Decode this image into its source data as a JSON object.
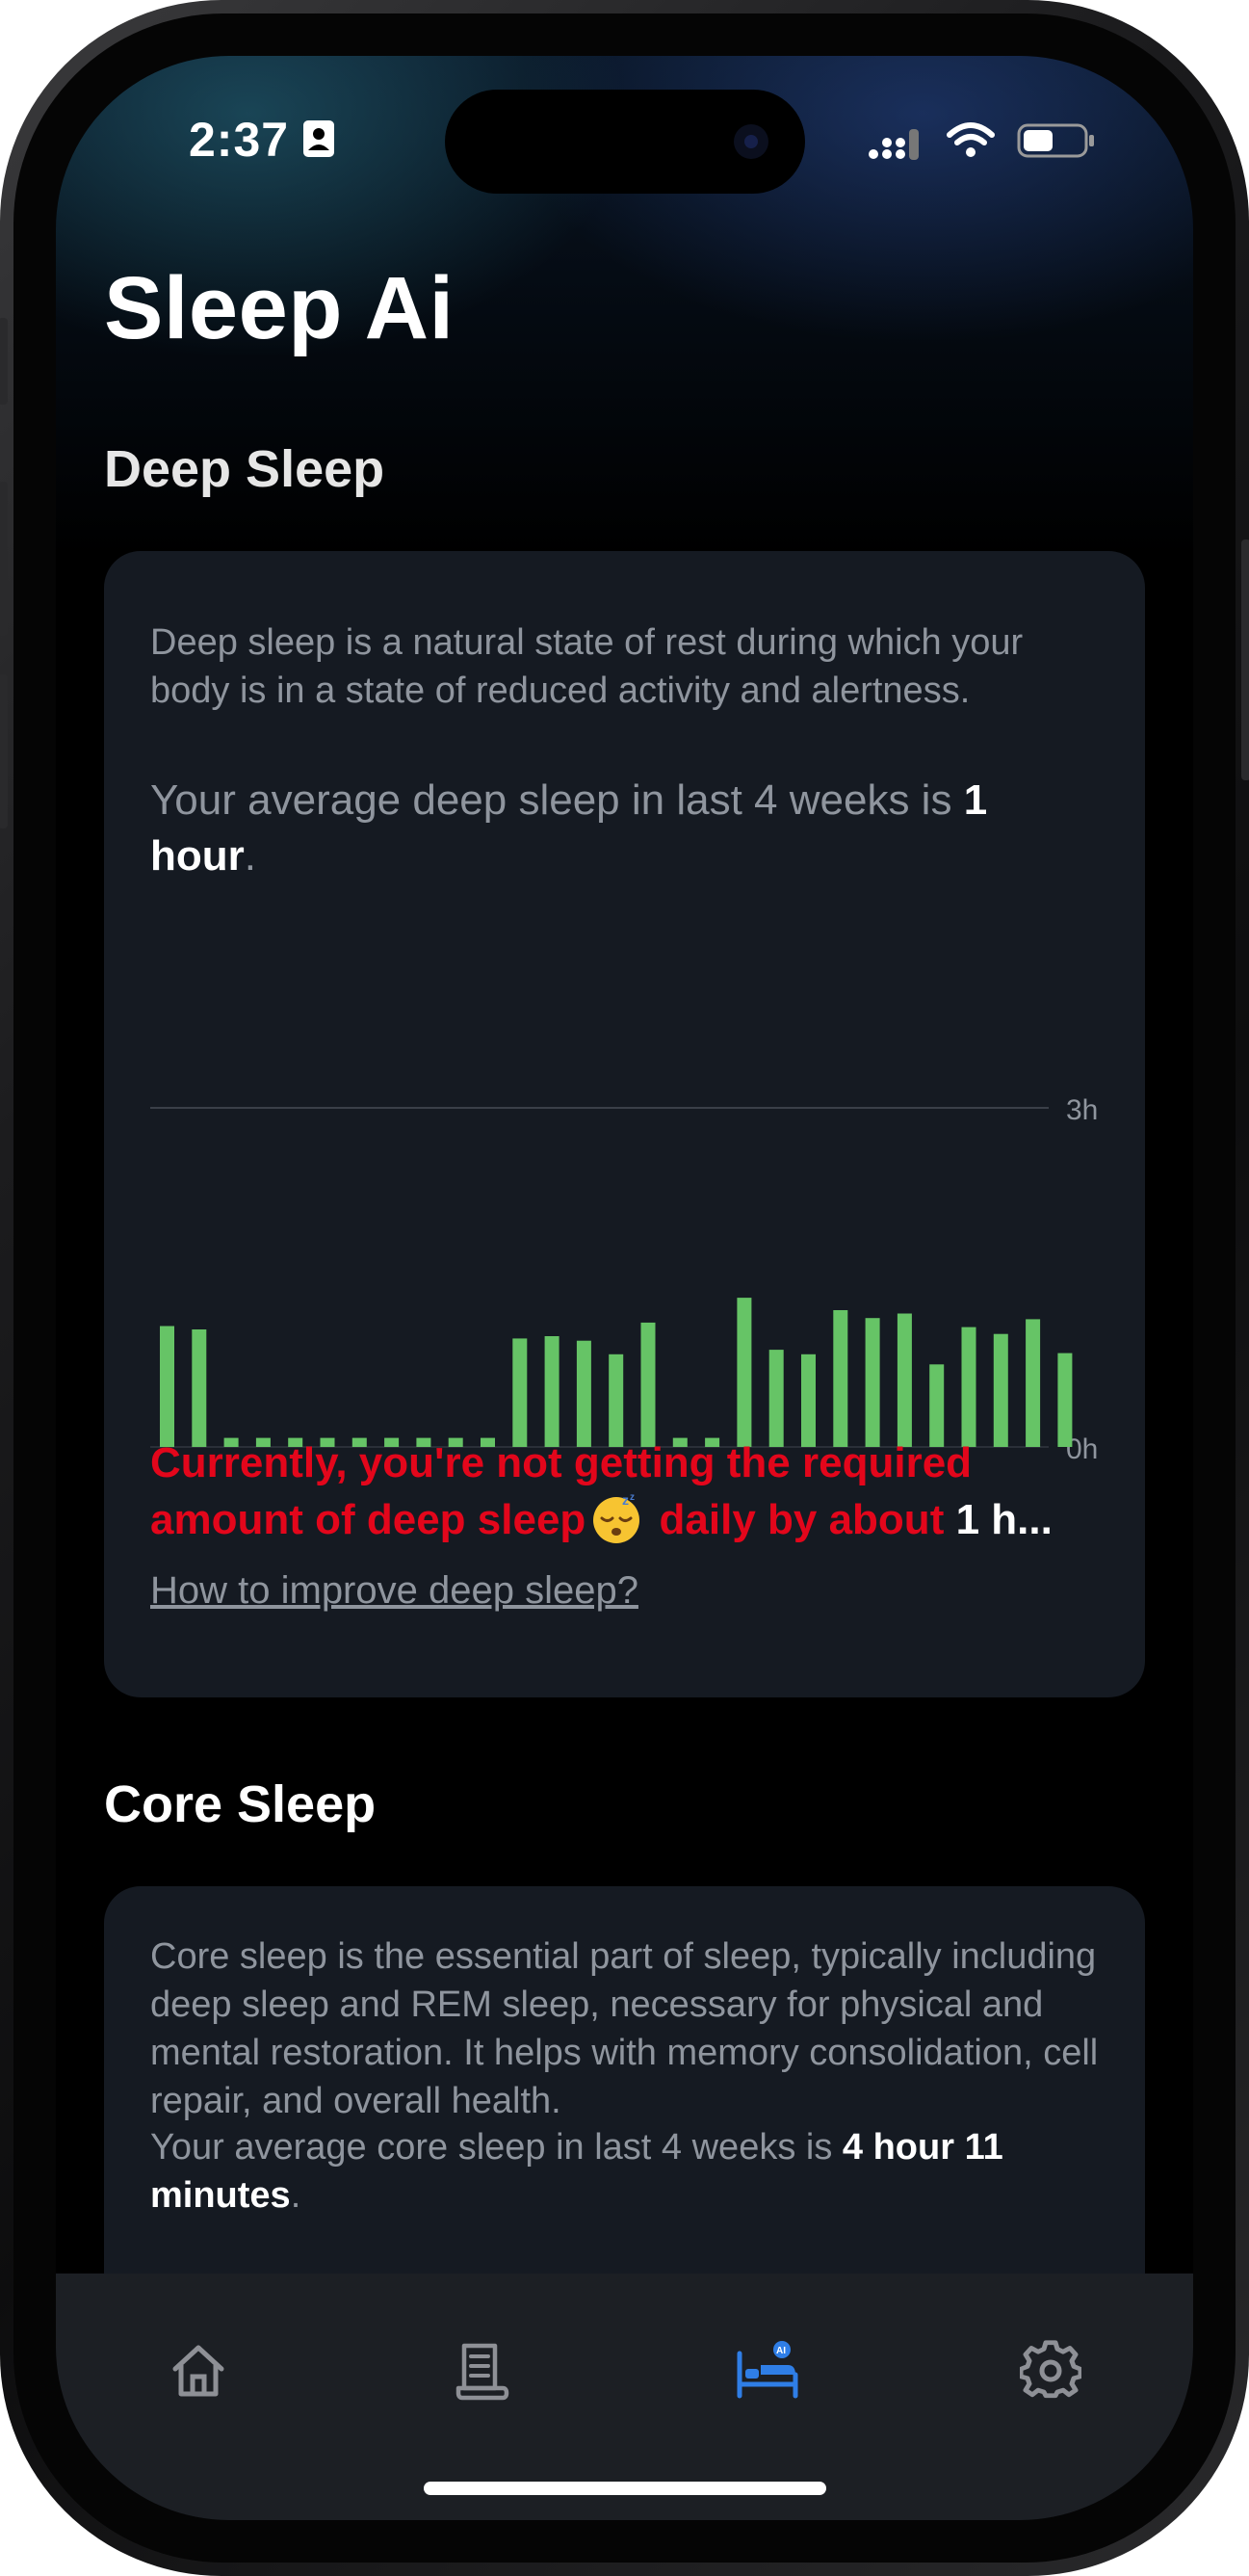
{
  "status_bar": {
    "time": "2:37"
  },
  "app": {
    "title": "Sleep Ai"
  },
  "deep_sleep": {
    "section_title": "Deep Sleep",
    "description": "Deep sleep is a natural state of rest during which your body is in a state of reduced activity and alertness.",
    "avg_prefix": "Your average deep sleep in last 4 weeks is ",
    "avg_value": "1 hour",
    "avg_suffix": ".",
    "warning_prefix": "Currently, you're not getting the required amount of deep sleep",
    "warning_middle": " daily by about ",
    "warning_value": "1 h...",
    "improve_link": "How to improve deep sleep?"
  },
  "core_sleep": {
    "section_title": "Core Sleep",
    "description": "Core sleep is the essential part of sleep, typically including deep sleep and REM sleep, necessary for physical and mental restoration. It helps with memory consolidation, cell repair, and overall health.",
    "avg_prefix": "Your average core sleep in last 4 weeks is ",
    "avg_value": "4 hour 11 minutes",
    "avg_suffix": "."
  },
  "chart_data": {
    "type": "bar",
    "unit": "hours",
    "ylim": [
      0,
      3
    ],
    "tick_labels": [
      "3h",
      "0h"
    ],
    "bar_color": "#66c466",
    "values": [
      1.07,
      1.04,
      0.08,
      0.08,
      0.08,
      0.08,
      0.08,
      0.08,
      0.08,
      0.08,
      0.08,
      0.96,
      0.98,
      0.94,
      0.82,
      1.1,
      0.08,
      0.08,
      1.32,
      0.86,
      0.82,
      1.21,
      1.14,
      1.18,
      0.73,
      1.06,
      1.0,
      1.13,
      0.83
    ]
  },
  "tab_bar": {
    "items": [
      {
        "name": "home",
        "icon": "home-icon",
        "active": false
      },
      {
        "name": "journal",
        "icon": "journal-icon",
        "active": false
      },
      {
        "name": "sleep-ai",
        "icon": "sleep-ai-icon",
        "active": true
      },
      {
        "name": "settings",
        "icon": "gear-icon",
        "active": false
      }
    ],
    "active_color": "#2f7ee6",
    "inactive_color": "#8e9096"
  }
}
